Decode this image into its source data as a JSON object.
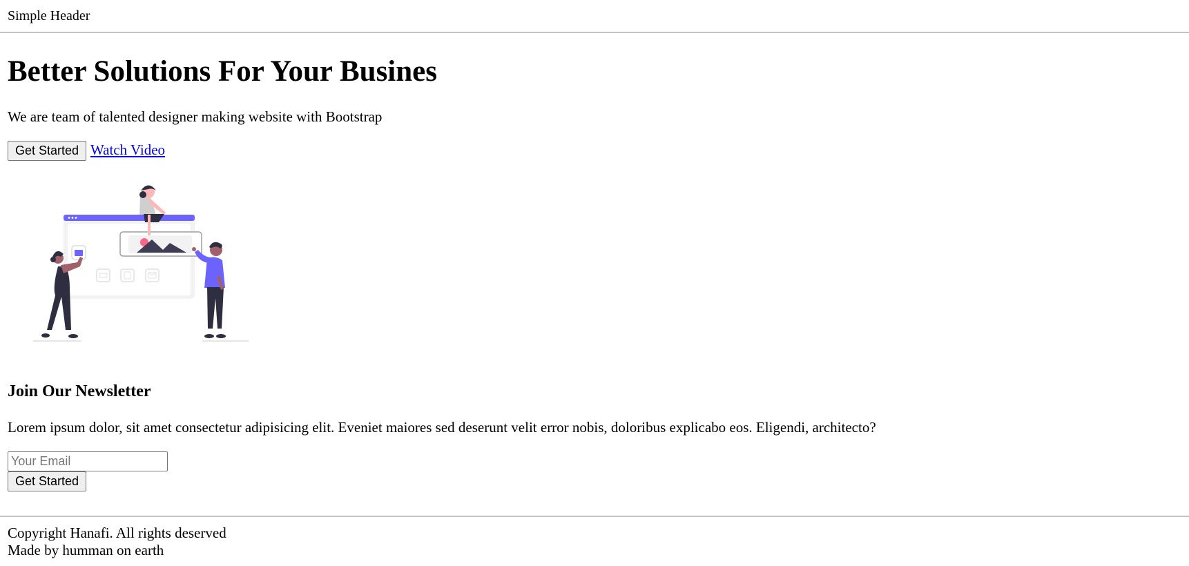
{
  "header": {
    "title": "Simple Header"
  },
  "hero": {
    "title": "Better Solutions For Your Busines",
    "subtitle": "We are team of talented designer making website with Bootstrap",
    "primary_button": "Get Started",
    "secondary_link": "Watch Video",
    "illustration": {
      "icon": "team-collaboration-illustration",
      "accent_color": "#6c63ff",
      "highlight_color": "#ff6584"
    }
  },
  "newsletter": {
    "title": "Join Our Newsletter",
    "text": "Lorem ipsum dolor, sit amet consectetur adipisicing elit. Eveniet maiores sed deserunt velit error nobis, doloribus explicabo eos. Eligendi, architecto?",
    "email_placeholder": "Your Email",
    "email_value": "",
    "button": "Get Started"
  },
  "footer": {
    "copyright": "Copyright Hanafi. All rights deserved",
    "made_by": "Made by humman on earth"
  }
}
